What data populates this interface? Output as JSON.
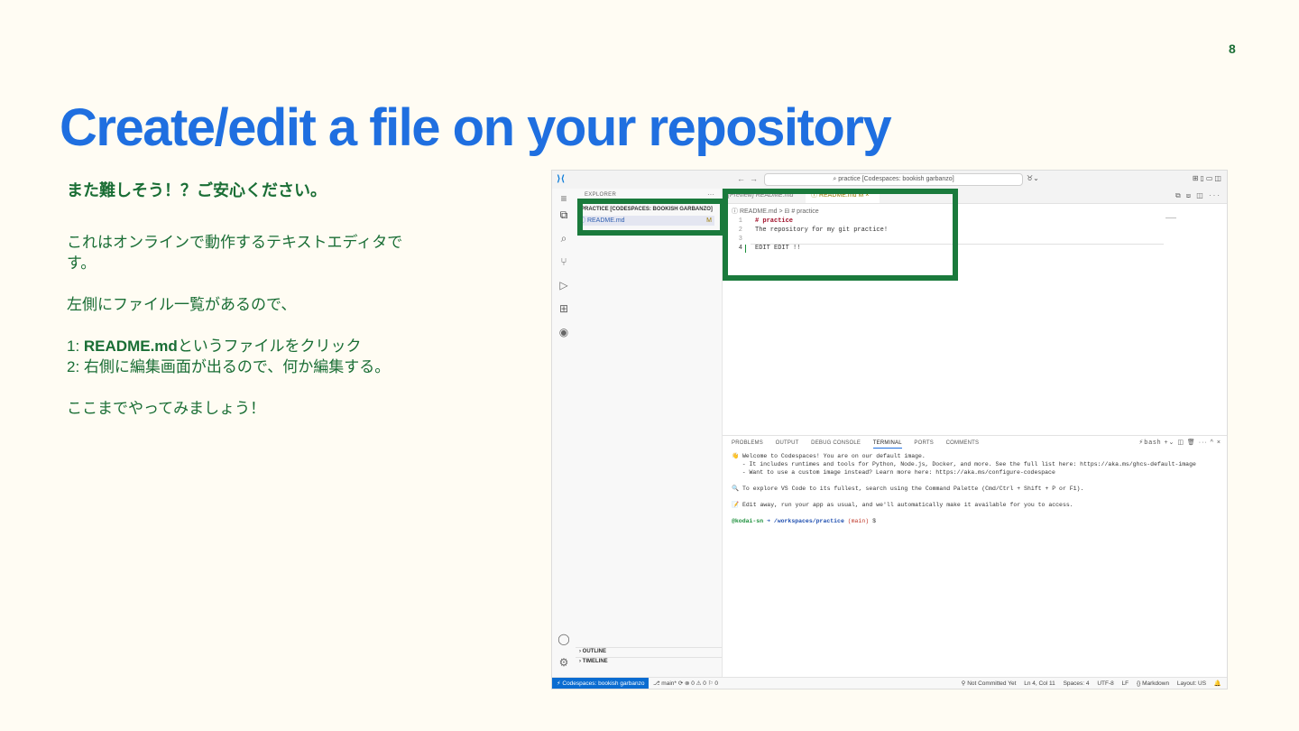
{
  "slide": {
    "page_number": "8",
    "title": "Create/edit a file on your repository",
    "subtitle": "また難しそう！？ご安心ください。",
    "line1a": "これはオンラインで動作するテキストエディタで",
    "line1b": "す。",
    "line2": "左側にファイル一覧があるので、",
    "step1_prefix": "1: ",
    "step1_bold": "README.md",
    "step1_rest": "というファイルをクリック",
    "step2": "2: 右側に編集画面が出るので、何か編集する。",
    "closing": "ここまでやってみましょう！"
  },
  "vscode": {
    "search_text": "⌕ practice [Codespaces: bookish garbanzo]",
    "explorer_label": "EXPLORER",
    "explorer_dots": "···",
    "project": "PRACTICE [CODESPACES: BOOKISH GARBANZO]",
    "file_name": "ⓘ README.md",
    "file_status": "M",
    "tab1": "[Preview] README.md",
    "tab2": "ⓘ README.md  M  ×",
    "breadcrumb": "ⓘ README.md  >  ⊟ # practice",
    "code": [
      {
        "n": "1",
        "t": "# practice"
      },
      {
        "n": "2",
        "t": "The repository for my git practice!"
      },
      {
        "n": "3",
        "t": ""
      },
      {
        "n": "4",
        "t": "EDIT EDIT !!"
      }
    ],
    "outline": "› OUTLINE",
    "timeline": "› TIMELINE",
    "panel_tabs": [
      "PROBLEMS",
      "OUTPUT",
      "DEBUG CONSOLE",
      "TERMINAL",
      "PORTS",
      "COMMENTS"
    ],
    "panel_icons": "⚡bash  +⌄  ◫  🗑  ···  ^  ×",
    "terminal": {
      "l1": "👋 Welcome to Codespaces! You are on our default image.",
      "l2": "   - It includes runtimes and tools for Python, Node.js, Docker, and more. See the full list here: https://aka.ms/ghcs-default-image",
      "l3": "   - Want to use a custom image instead? Learn more here: https://aka.ms/configure-codespace",
      "l4": "🔍 To explore VS Code to its fullest, search using the Command Palette (Cmd/Ctrl + Shift + P or F1).",
      "l5": "📝 Edit away, run your app as usual, and we'll automatically make it available for you to access.",
      "prompt_user": "@kodai-sn ",
      "prompt_path": "➜ /workspaces/practice ",
      "prompt_branch": "(main) ",
      "prompt_end": "$"
    },
    "status": {
      "remote": "⚡ Codespaces: bookish garbanzo",
      "left": "⎇ main*  ⟳   ⊗ 0 ⚠ 0   ⚐ 0",
      "items": [
        "⚲ Not Committed Yet",
        "Ln 4, Col 11",
        "Spaces: 4",
        "UTF-8",
        "LF",
        "{} Markdown",
        "Layout: US",
        "🔔"
      ]
    }
  }
}
